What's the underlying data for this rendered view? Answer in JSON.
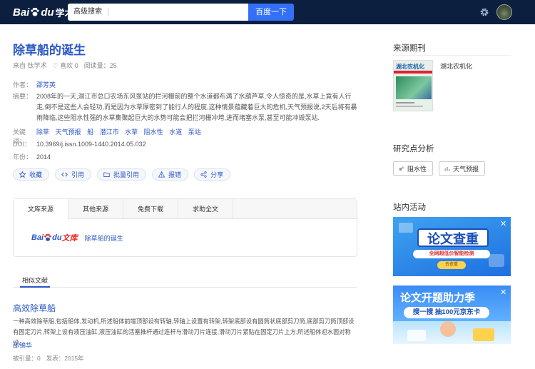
{
  "header": {
    "logo_bai": "Bai",
    "logo_du": "du",
    "logo_xueshu": "学术",
    "search_mode": "高级搜索",
    "search_value": "",
    "search_button": "百度一下",
    "colors": {
      "bar": "#0c1f3f",
      "accent": "#3370f5"
    }
  },
  "article": {
    "title": "除草船的诞生",
    "source_from": "来自 钛学术",
    "likes": "♡ 喜欢 0",
    "reads": "阅读量：25",
    "author_label": "作者：",
    "author": "邵芳英",
    "abstract_label": "摘要：",
    "abstract": "2008年的一天,潜江市总口农场东风泵站的拦河栅前的整个水道都布满了水葫芦草,令人惊奇的是,水草上竟有人行走,倒不是这些人会轻功,而是因为水草厚密到了能行人的程度,这种情景蕴藏着巨大的危机,天气预报说,2天后将有暴雨降临,这些阻水性强的水草集聚起巨大的水势可能会把拦河栅冲垮,进而堵塞水泵,甚至可能冲毁泵站.",
    "keywords_label": "关键词：",
    "keywords": [
      "除草",
      "天气预报",
      "船",
      "潜江市",
      "水草",
      "阻水性",
      "水道",
      "泵站"
    ],
    "doi_label": "DOI：",
    "doi": "10.3969/j.issn.1009-1440.2014.05.032",
    "year_label": "年份：",
    "year": "2014"
  },
  "actions": [
    {
      "label": "收藏",
      "icon": "star-icon"
    },
    {
      "label": "引用",
      "icon": "code-icon"
    },
    {
      "label": "批量引用",
      "icon": "folder-icon"
    },
    {
      "label": "报错",
      "icon": "warning-icon"
    },
    {
      "label": "分享",
      "icon": "share-icon"
    }
  ],
  "source_tabs": [
    "文库来源",
    "其他来源",
    "免费下载",
    "求助全文"
  ],
  "source_entry": {
    "logo_bai": "Bai",
    "logo_du": "du",
    "logo_wenku": "文库",
    "title": "除草船的诞生"
  },
  "similar": {
    "tab": "相似文献",
    "items": [
      {
        "title": "高效除草船",
        "abstract": "一种高效除草船,包括船体,发动机,所述船体前端顶部设有转轴,转轴上设置有转架,转架底部设有圆筒状底部剪刀筒,底部剪刀筒顶部设有固定刀片,转架上设有液压油缸,液压油缸的活塞推杆通过连杆与滑动刀片连接,滑动刀片紧贴在固定刀片上方;所述船体迎水面对称设...",
        "author": "邵锦华",
        "cited": "被引量：0",
        "published": "发表：2015年"
      }
    ]
  },
  "sidebar": {
    "journal_heading": "来源期刊",
    "journal_name": "湖北农机化",
    "cover_title": "湖北农机化",
    "analysis_heading": "研究点分析",
    "analysis_tags": [
      "阻水性",
      "天气预报"
    ],
    "activity_heading": "站内活动",
    "ad1": {
      "title": "论文查重",
      "subtitle": "全网超低价智能检测",
      "button": "去查重"
    },
    "ad2": {
      "title": "论文开题助力季",
      "subtitle": "搜一搜 抽100元京东卡"
    }
  }
}
